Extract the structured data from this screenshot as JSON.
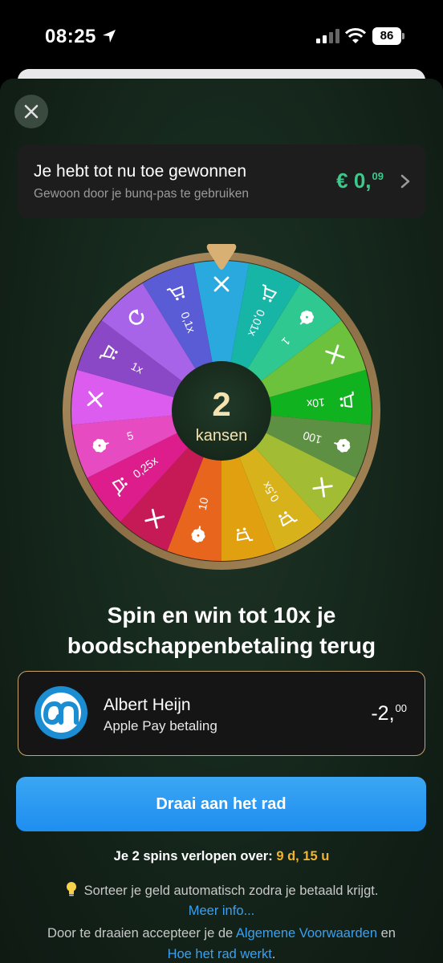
{
  "status_bar": {
    "time": "08:25",
    "battery": "86"
  },
  "header": {
    "close_icon": "close-icon"
  },
  "winnings": {
    "title": "Je hebt tot nu toe gewonnen",
    "subtitle": "Gewoon door je bunq-pas te gebruiken",
    "amount_main": "€ 0,",
    "amount_cents": "09"
  },
  "wheel": {
    "count": "2",
    "count_label": "kansen",
    "segments": [
      {
        "color": "#29a9de",
        "icon": "x",
        "label": ""
      },
      {
        "color": "#17b5a6",
        "icon": "cart",
        "label": "0,01x"
      },
      {
        "color": "#2fc891",
        "icon": "flower",
        "label": "1"
      },
      {
        "color": "#6cc23c",
        "icon": "x",
        "label": ""
      },
      {
        "color": "#10b21f",
        "icon": "cart",
        "label": "10x"
      },
      {
        "color": "#5e9043",
        "icon": "flower",
        "label": "100"
      },
      {
        "color": "#a2bd34",
        "icon": "x",
        "label": ""
      },
      {
        "color": "#d8b21b",
        "icon": "cart",
        "label": "0,5x"
      },
      {
        "color": "#e1a010",
        "icon": "cart",
        "label": ""
      },
      {
        "color": "#e8651d",
        "icon": "flower",
        "label": "10"
      },
      {
        "color": "#c61a57",
        "icon": "x",
        "label": ""
      },
      {
        "color": "#de1d8d",
        "icon": "cart",
        "label": "0,25x"
      },
      {
        "color": "#e64bc1",
        "icon": "flower",
        "label": "5"
      },
      {
        "color": "#dd5cf0",
        "icon": "x",
        "label": ""
      },
      {
        "color": "#8a47c6",
        "icon": "cart",
        "label": "1x"
      },
      {
        "color": "#a864e8",
        "icon": "refresh",
        "label": ""
      },
      {
        "color": "#5a5cd6",
        "icon": "cart",
        "label": "0,1x"
      }
    ]
  },
  "promo": {
    "line1": "Spin en win tot 10x je",
    "line2": "boodschappenbetaling terug"
  },
  "transaction": {
    "merchant": "Albert Heijn",
    "method": "Apple Pay betaling",
    "amount_main": "-2,",
    "amount_cents": "00"
  },
  "spin_button": {
    "label": "Draai aan het rad"
  },
  "expiry": {
    "prefix": "Je 2 spins verlopen over:",
    "value": "9 d, 15 u"
  },
  "tip": {
    "text": "Sorteer je geld automatisch zodra je betaald krijgt.",
    "more": "Meer info..."
  },
  "terms": {
    "prefix": "Door te draaien accepteer je de",
    "link1": "Algemene Voorwaarden",
    "middle": "en",
    "link2": "Hoe het rad werkt",
    "suffix": "."
  },
  "colors": {
    "accent": "#1e8ef0",
    "win_green": "#3cc98a",
    "gold": "#c9a56a",
    "expiry": "#f1b42f"
  }
}
